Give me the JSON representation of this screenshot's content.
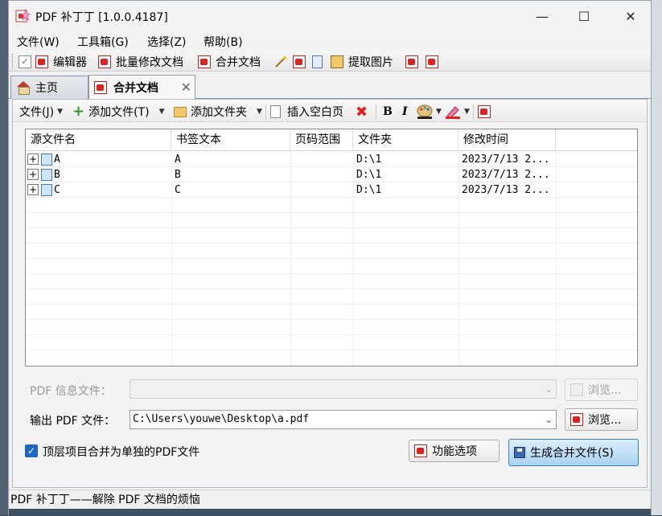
{
  "window": {
    "title": "PDF 补丁丁 [1.0.0.4187]",
    "minimize": "—",
    "maximize": "☐",
    "close": "✕"
  },
  "menu": [
    {
      "label": "文件(W)"
    },
    {
      "label": "工具箱(G)"
    },
    {
      "label": "选择(Z)"
    },
    {
      "label": "帮助(B)"
    }
  ],
  "toolbar": {
    "editor": "编辑器",
    "batch_modify": "批量修改文档",
    "merge": "合并文档",
    "extract_images": "提取图片"
  },
  "tabs": [
    {
      "label": "主页"
    },
    {
      "label": "合并文档",
      "close": "✕"
    }
  ],
  "merge_toolbar": {
    "file": "文件(J)",
    "add_file": "添加文件(T)",
    "add_folder": "添加文件夹",
    "insert_blank": "插入空白页",
    "bold": "B",
    "italic": "I"
  },
  "grid": {
    "columns": [
      "源文件名",
      "书签文本",
      "页码范围",
      "文件夹",
      "修改时间"
    ],
    "rows": [
      {
        "expander": "+",
        "name": "A",
        "bookmark": "A",
        "pages": "",
        "folder": "D:\\1",
        "modified": "2023/7/13 2..."
      },
      {
        "expander": "+",
        "name": "B",
        "bookmark": "B",
        "pages": "",
        "folder": "D:\\1",
        "modified": "2023/7/13 2..."
      },
      {
        "expander": "+",
        "name": "C",
        "bookmark": "C",
        "pages": "",
        "folder": "D:\\1",
        "modified": "2023/7/13 2..."
      }
    ]
  },
  "form": {
    "info_label": "PDF 信息文件：",
    "info_value": "",
    "browse_disabled": "浏览...",
    "output_label": "输出 PDF 文件：",
    "output_value": "C:\\Users\\youwe\\Desktop\\a.pdf",
    "browse": "浏览...",
    "merge_top_level_label": "顶层项目合并为单独的PDF文件",
    "merge_top_level_checked": true,
    "options_button": "功能选项",
    "generate_button": "生成合并文件(S)"
  },
  "status": {
    "text": "PDF 补丁丁——解除 PDF 文档的烦恼"
  }
}
